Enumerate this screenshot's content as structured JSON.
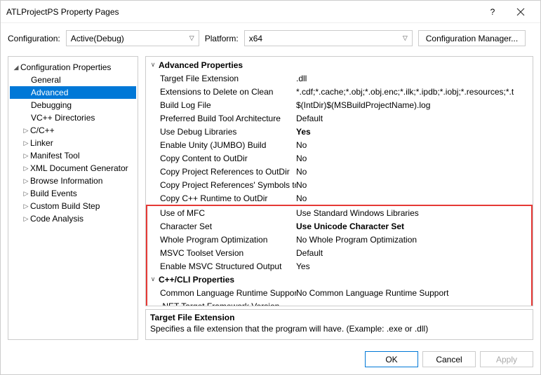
{
  "titlebar": {
    "title": "ATLProjectPS Property Pages",
    "help": "?",
    "close": "×"
  },
  "confRow": {
    "configLabel": "Configuration:",
    "configValue": "Active(Debug)",
    "platformLabel": "Platform:",
    "platformValue": "x64",
    "managerBtn": "Configuration Manager..."
  },
  "tree": [
    {
      "label": "Configuration Properties",
      "depth": 1,
      "expanded": true
    },
    {
      "label": "General",
      "depth": 2
    },
    {
      "label": "Advanced",
      "depth": 2,
      "selected": true
    },
    {
      "label": "Debugging",
      "depth": 2
    },
    {
      "label": "VC++ Directories",
      "depth": 2
    },
    {
      "label": "C/C++",
      "depth": 2,
      "hasChildren": true
    },
    {
      "label": "Linker",
      "depth": 2,
      "hasChildren": true
    },
    {
      "label": "Manifest Tool",
      "depth": 2,
      "hasChildren": true
    },
    {
      "label": "XML Document Generator",
      "depth": 2,
      "hasChildren": true
    },
    {
      "label": "Browse Information",
      "depth": 2,
      "hasChildren": true
    },
    {
      "label": "Build Events",
      "depth": 2,
      "hasChildren": true
    },
    {
      "label": "Custom Build Step",
      "depth": 2,
      "hasChildren": true
    },
    {
      "label": "Code Analysis",
      "depth": 2,
      "hasChildren": true
    }
  ],
  "grid": {
    "section1": {
      "title": "Advanced Properties",
      "rows": [
        {
          "key": "Target File Extension",
          "val": ".dll"
        },
        {
          "key": "Extensions to Delete on Clean",
          "val": "*.cdf;*.cache;*.obj;*.obj.enc;*.ilk;*.ipdb;*.iobj;*.resources;*.t"
        },
        {
          "key": "Build Log File",
          "val": "$(IntDir)$(MSBuildProjectName).log"
        },
        {
          "key": "Preferred Build Tool Architecture",
          "val": "Default"
        },
        {
          "key": "Use Debug Libraries",
          "val": "Yes",
          "bold": true
        },
        {
          "key": "Enable Unity (JUMBO) Build",
          "val": "No"
        },
        {
          "key": "Copy Content to OutDir",
          "val": "No"
        },
        {
          "key": "Copy Project References to OutDir",
          "val": "No"
        },
        {
          "key": "Copy Project References' Symbols to OutDir",
          "val": "No"
        },
        {
          "key": "Copy C++ Runtime to OutDir",
          "val": "No"
        }
      ]
    },
    "highlight": {
      "rows": [
        {
          "key": "Use of MFC",
          "val": "Use Standard Windows Libraries"
        },
        {
          "key": "Character Set",
          "val": "Use Unicode Character Set",
          "bold": true
        },
        {
          "key": "Whole Program Optimization",
          "val": "No Whole Program Optimization"
        },
        {
          "key": "MSVC Toolset Version",
          "val": "Default"
        },
        {
          "key": "Enable MSVC Structured Output",
          "val": "Yes"
        }
      ],
      "section2": {
        "title": "C++/CLI Properties",
        "rows": [
          {
            "key": "Common Language Runtime Support",
            "val": "No Common Language Runtime Support"
          },
          {
            "key": ".NET Target Framework Version",
            "val": ""
          }
        ]
      }
    }
  },
  "desc": {
    "title": "Target File Extension",
    "text": "Specifies a file extension that the program will have. (Example: .exe or .dll)"
  },
  "footer": {
    "ok": "OK",
    "cancel": "Cancel",
    "apply": "Apply"
  }
}
